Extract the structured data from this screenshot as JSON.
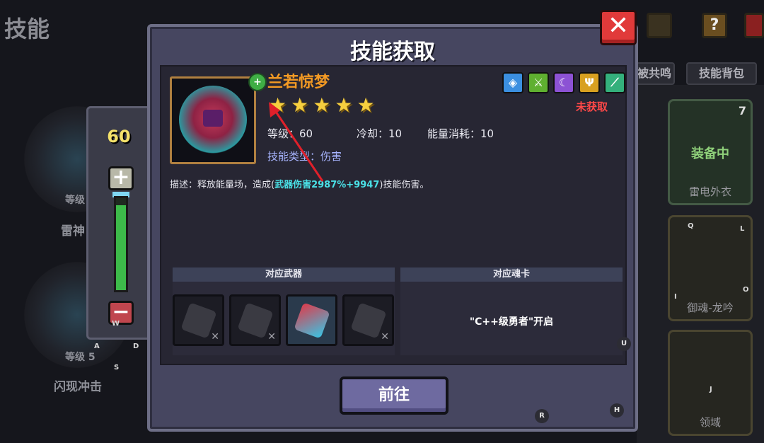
{
  "background": {
    "title": "技能",
    "tabs": [
      "被共鸣",
      "技能背包"
    ],
    "left_skills": [
      {
        "name": "雷神",
        "level": "等级"
      },
      {
        "name": "闪现冲击",
        "level": "等级 5"
      }
    ],
    "right_cards": [
      {
        "label": "雷电外衣",
        "status": "装备中",
        "count": "7"
      },
      {
        "label": "御魂-龙吟"
      },
      {
        "label": "领域"
      }
    ]
  },
  "slider": {
    "value": "60",
    "plus_label": "+",
    "minus_label": "−",
    "fill_fraction": 0.92
  },
  "key_hints": {
    "W": "W",
    "A": "A",
    "S": "S",
    "D": "D",
    "Q": "Q",
    "L": "L",
    "I": "I",
    "O": "O",
    "J": "J",
    "U": "U",
    "R": "R",
    "H": "H"
  },
  "dialog": {
    "title": "技能获取",
    "close_label": "✕",
    "skill": {
      "name": "兰若惊梦",
      "stars": 5,
      "level_label": "等级：60",
      "cooldown_label": "冷却：10",
      "energy_label": "能量消耗：10",
      "type_label": "技能类型：伤害",
      "status": "未获取",
      "desc_prefix": "描述：释放能量场，造成(",
      "desc_highlight": "武器伤害2987%+9947",
      "desc_suffix": ")技能伤害。"
    },
    "element_icons": [
      {
        "icon": "shield-icon",
        "glyph": "◈",
        "color": "#3b8fe0"
      },
      {
        "icon": "sword-icon",
        "glyph": "⚔",
        "color": "#5fb030"
      },
      {
        "icon": "moon-icon",
        "glyph": "☾",
        "color": "#8c52d4"
      },
      {
        "icon": "trident-icon",
        "glyph": "Ψ",
        "color": "#d8a020"
      },
      {
        "icon": "blade-icon",
        "glyph": "⟋",
        "color": "#34b07c"
      }
    ],
    "weapons_header": "对应武器",
    "soulcard_header": "对应魂卡",
    "unlock_text": "\"C++级勇者\"开启",
    "go_button": "前往"
  }
}
